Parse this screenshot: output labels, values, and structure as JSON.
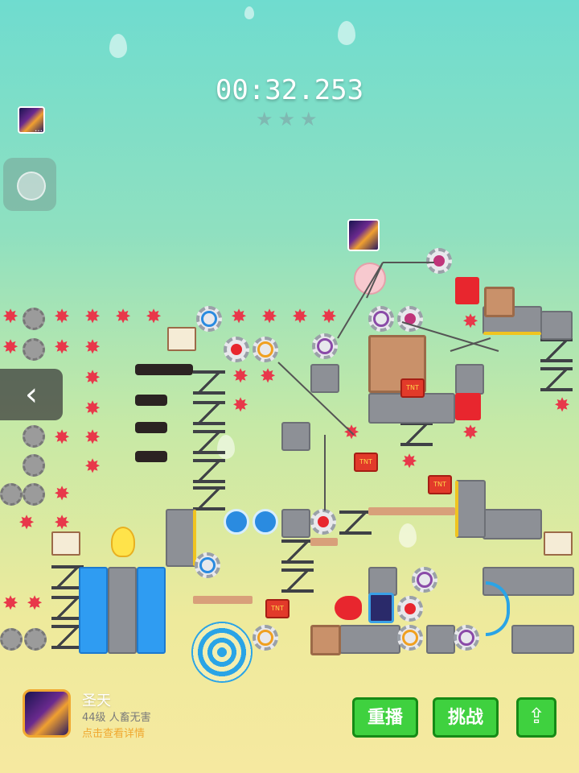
{
  "timer": "00:32.253",
  "stars": {
    "earned": 0,
    "total": 3
  },
  "user": {
    "name": "圣天",
    "level_title": "44级 人畜无害",
    "details_link": "点击查看详情"
  },
  "buttons": {
    "replay": "重播",
    "challenge": "挑战",
    "share_icon": "share-icon"
  },
  "icons": {
    "back": "chevron-left-icon",
    "joystick": "joystick-icon",
    "star": "★",
    "menu_dots": "…"
  },
  "colors": {
    "accent_green": "#3fd13f",
    "brand_orange": "#f0a830",
    "hazard_red": "#e8384a",
    "water_blue": "#2f9cf2"
  }
}
